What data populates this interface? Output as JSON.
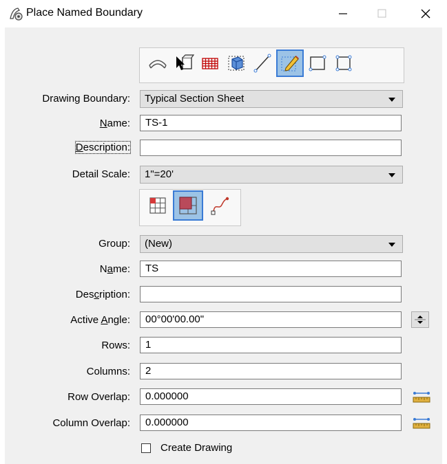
{
  "window": {
    "title": "Place Named Boundary",
    "app_icon": "place-boundary-app-icon",
    "controls": [
      "minimize-icon",
      "maximize-icon",
      "close-icon"
    ]
  },
  "method_toolbar": {
    "tools": [
      {
        "id": "civil-plan",
        "icon": "civil-arc-boundary-icon",
        "active": false
      },
      {
        "id": "select",
        "icon": "cursor-cube-icon",
        "active": false
      },
      {
        "id": "grid",
        "icon": "red-grid-icon",
        "active": false
      },
      {
        "id": "view",
        "icon": "3d-view-icon",
        "active": false
      },
      {
        "id": "line",
        "icon": "line-icon",
        "active": false
      },
      {
        "id": "profile",
        "icon": "pencil-icon",
        "active": true
      },
      {
        "id": "rect",
        "icon": "rectangle-icon",
        "active": false
      },
      {
        "id": "shape",
        "icon": "shape-icon",
        "active": false
      }
    ]
  },
  "drawing_boundary": {
    "label": "Drawing Boundary:",
    "value": "Typical Section Sheet"
  },
  "name": {
    "label_pre": "",
    "label_u": "N",
    "label_post": "ame:",
    "value": "TS-1"
  },
  "description": {
    "label_pre": "",
    "label_u": "D",
    "label_post": "escription:",
    "value": ""
  },
  "detail_scale": {
    "label": "Detail Scale:",
    "value": "1\"=20'"
  },
  "mode_toolbar": {
    "tools": [
      {
        "id": "single",
        "icon": "single-grid-icon",
        "active": false
      },
      {
        "id": "multi",
        "icon": "multi-grid-icon",
        "active": true
      },
      {
        "id": "curve",
        "icon": "curve-icon",
        "active": false
      }
    ]
  },
  "group": {
    "label": "Group:",
    "value": "(New)"
  },
  "group_name": {
    "label_pre": "N",
    "label_u": "a",
    "label_post": "me:",
    "value": "TS"
  },
  "group_description": {
    "label_pre": "Des",
    "label_u": "c",
    "label_post": "ription:",
    "value": ""
  },
  "active_angle": {
    "label_pre": "Active ",
    "label_u": "A",
    "label_post": "ngle:",
    "value": "00°00'00.00\""
  },
  "rows": {
    "label": "Rows:",
    "value": "1"
  },
  "columns": {
    "label": "Columns:",
    "value": "2"
  },
  "row_overlap": {
    "label": "Row Overlap:",
    "value": "0.000000"
  },
  "column_overlap": {
    "label": "Column Overlap:",
    "value": "0.000000"
  },
  "create_drawing": {
    "label": "Create Drawing",
    "checked": false
  },
  "colors": {
    "accent": "#3a7bd5",
    "active_fill": "#9cc3e6"
  }
}
